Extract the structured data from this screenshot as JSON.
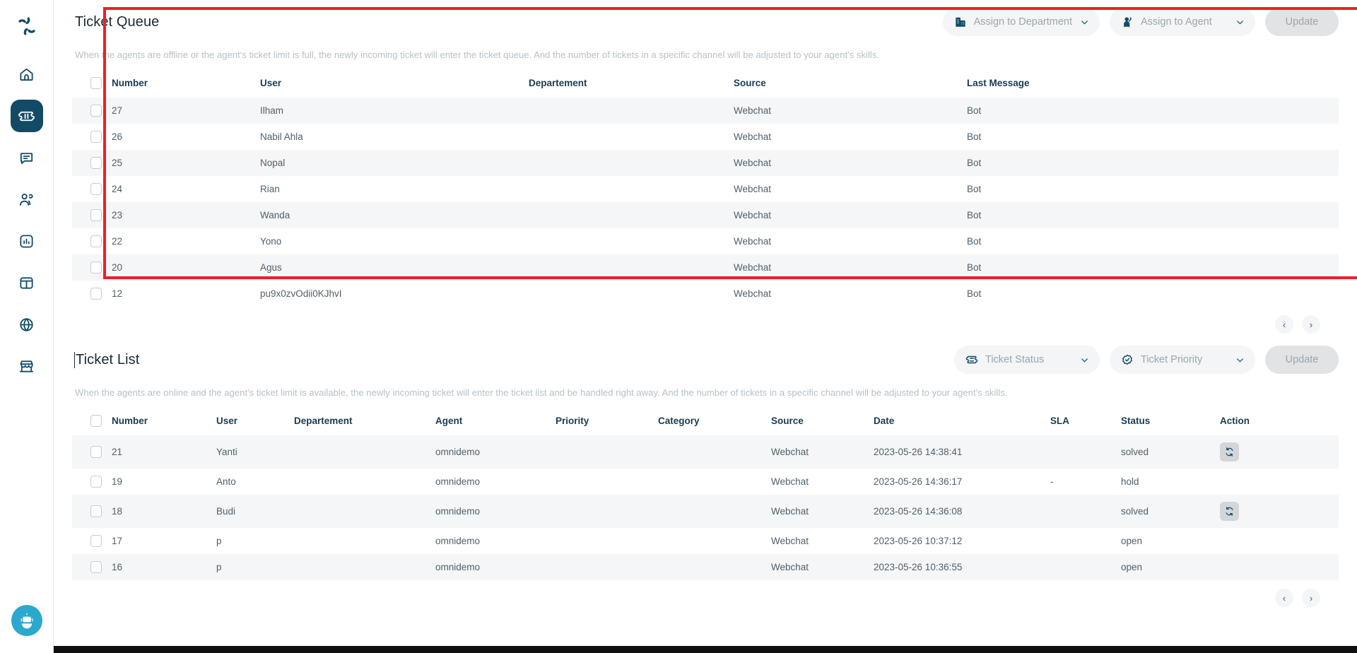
{
  "sidebar": {
    "logo_icon": "pinwheel-logo-icon",
    "items": [
      {
        "name": "home",
        "icon": "home-icon",
        "active": false
      },
      {
        "name": "ticket",
        "icon": "ticket-icon",
        "active": true
      },
      {
        "name": "chat",
        "icon": "chat-bubble-icon",
        "active": false
      },
      {
        "name": "contacts",
        "icon": "users-icon",
        "active": false
      },
      {
        "name": "analytics",
        "icon": "bar-chart-icon",
        "active": false
      },
      {
        "name": "boxes",
        "icon": "box-icon",
        "active": false
      },
      {
        "name": "channels",
        "icon": "globe-icon",
        "active": false
      },
      {
        "name": "store",
        "icon": "storefront-icon",
        "active": false
      }
    ],
    "bot_icon": "robot-avatar-icon"
  },
  "queue": {
    "title": "Ticket Queue",
    "description": "When the agents are offline or the agent's ticket limit is full, the newly incoming ticket will enter the ticket queue. And the number of tickets in a specific channel will be adjusted to your agent's skills.",
    "controls": {
      "department": {
        "label": "Assign to Department",
        "icon": "building-icon",
        "chevron": "chevron-down-icon"
      },
      "agent": {
        "label": "Assign to Agent",
        "icon": "agent-person-icon",
        "chevron": "chevron-down-icon"
      },
      "update": "Update"
    },
    "columns": [
      "Number",
      "User",
      "Departement",
      "Source",
      "Last Message"
    ],
    "rows": [
      {
        "number": "27",
        "user": "Ilham",
        "departement": "",
        "source": "Webchat",
        "last_message": "Bot"
      },
      {
        "number": "26",
        "user": "Nabil Ahla",
        "departement": "",
        "source": "Webchat",
        "last_message": "Bot"
      },
      {
        "number": "25",
        "user": "Nopal",
        "departement": "",
        "source": "Webchat",
        "last_message": "Bot"
      },
      {
        "number": "24",
        "user": "Rian",
        "departement": "",
        "source": "Webchat",
        "last_message": "Bot"
      },
      {
        "number": "23",
        "user": "Wanda",
        "departement": "",
        "source": "Webchat",
        "last_message": "Bot"
      },
      {
        "number": "22",
        "user": "Yono",
        "departement": "",
        "source": "Webchat",
        "last_message": "Bot"
      },
      {
        "number": "20",
        "user": "Agus",
        "departement": "",
        "source": "Webchat",
        "last_message": "Bot"
      },
      {
        "number": "12",
        "user": "pu9x0zvOdii0KJhvI",
        "departement": "",
        "source": "Webchat",
        "last_message": "Bot"
      }
    ],
    "pager": {
      "prev": "‹",
      "next": "›"
    }
  },
  "list": {
    "title": "Ticket List",
    "description": "When the agents are online and the agent's ticket limit is available, the newly incoming ticket will enter the ticket list and be handled right away. And the number of tickets in a specific channel will be adjusted to your agent's skills.",
    "controls": {
      "status": {
        "label": "Ticket Status",
        "icon": "ticket-status-icon",
        "chevron": "chevron-down-icon"
      },
      "priority": {
        "label": "Ticket Priority",
        "icon": "check-badge-icon",
        "chevron": "chevron-down-icon"
      },
      "update": "Update"
    },
    "columns": [
      "Number",
      "User",
      "Departement",
      "Agent",
      "Priority",
      "Category",
      "Source",
      "Date",
      "SLA",
      "Status",
      "Action"
    ],
    "rows": [
      {
        "number": "21",
        "user": "Yanti",
        "departement": "",
        "agent": "omnidemo",
        "priority": "",
        "category": "",
        "source": "Webchat",
        "date": "2023-05-26 14:38:41",
        "sla": "",
        "status": "solved",
        "action": "refresh-icon"
      },
      {
        "number": "19",
        "user": "Anto",
        "departement": "",
        "agent": "omnidemo",
        "priority": "",
        "category": "",
        "source": "Webchat",
        "date": "2023-05-26 14:36:17",
        "sla": "-",
        "status": "hold",
        "action": ""
      },
      {
        "number": "18",
        "user": "Budi",
        "departement": "",
        "agent": "omnidemo",
        "priority": "",
        "category": "",
        "source": "Webchat",
        "date": "2023-05-26 14:36:08",
        "sla": "",
        "status": "solved",
        "action": "refresh-icon"
      },
      {
        "number": "17",
        "user": "p",
        "departement": "",
        "agent": "omnidemo",
        "priority": "",
        "category": "",
        "source": "Webchat",
        "date": "2023-05-26 10:37:12",
        "sla": "",
        "status": "open",
        "action": ""
      },
      {
        "number": "16",
        "user": "p",
        "departement": "",
        "agent": "omnidemo",
        "priority": "",
        "category": "",
        "source": "Webchat",
        "date": "2023-05-26 10:36:55",
        "sla": "",
        "status": "open",
        "action": ""
      }
    ],
    "pager": {
      "prev": "‹",
      "next": "›"
    }
  },
  "colors": {
    "brand": "#134b66",
    "highlight": "#ed2024",
    "pill_bg": "#f3f5f6",
    "bot": "#2ba8cd"
  }
}
